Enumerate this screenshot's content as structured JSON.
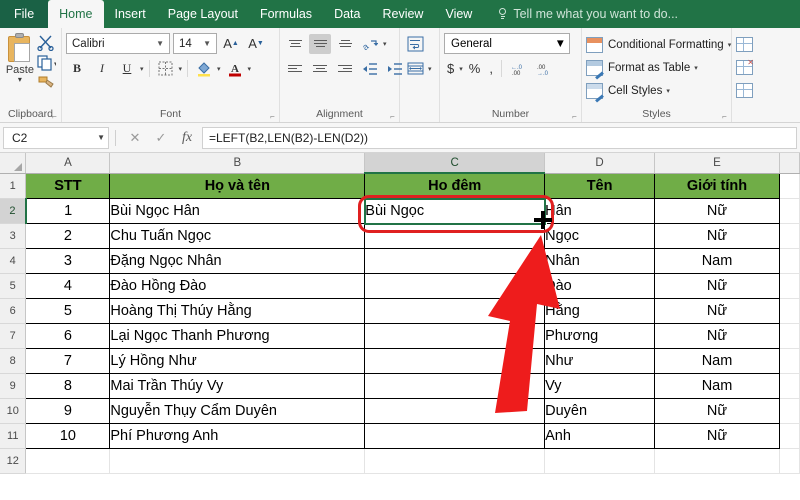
{
  "window": {
    "tabs": [
      {
        "label": "File",
        "active": false,
        "file": true
      },
      {
        "label": "Home",
        "active": true,
        "file": false
      },
      {
        "label": "Insert",
        "active": false,
        "file": false
      },
      {
        "label": "Page Layout",
        "active": false,
        "file": false
      },
      {
        "label": "Formulas",
        "active": false,
        "file": false
      },
      {
        "label": "Data",
        "active": false,
        "file": false
      },
      {
        "label": "Review",
        "active": false,
        "file": false
      },
      {
        "label": "View",
        "active": false,
        "file": false
      }
    ],
    "tell_me": "Tell me what you want to do...",
    "accent_green": "#217346",
    "header_fill": "#70ad47"
  },
  "ribbon": {
    "clipboard": {
      "label": "Clipboard",
      "paste_label": "Paste",
      "cut_icon": "scissors-icon",
      "copy_icon": "copy-icon",
      "format_painter_icon": "format-painter-icon"
    },
    "font": {
      "label": "Font",
      "font_name": "Calibri",
      "font_size": "14",
      "grow_label": "A",
      "shrink_label": "A",
      "bold_label": "B",
      "italic_label": "I",
      "underline_label": "U",
      "borders_icon": "borders-icon",
      "fill_color_icon": "fill-color-icon",
      "font_color_label": "A"
    },
    "alignment": {
      "label": "Alignment",
      "orientation_icon": "orientation-icon",
      "wrap_text_icon": "wrap-text-icon",
      "merge_center_icon": "merge-and-center-icon"
    },
    "number": {
      "label": "Number",
      "format": "General",
      "currency_label": "$",
      "percent_label": "%",
      "comma_label": ",",
      "increase_decimal_icon": "increase-decimal-icon",
      "decrease_decimal_icon": "decrease-decimal-icon"
    },
    "styles": {
      "label": "Styles",
      "items": [
        {
          "label": "Conditional Formatting",
          "icon": "conditional-formatting-icon"
        },
        {
          "label": "Format as Table",
          "icon": "format-as-table-icon"
        },
        {
          "label": "Cell Styles",
          "icon": "cell-styles-icon"
        }
      ]
    },
    "cells": {
      "items": [
        {
          "icon": "insert-cells-icon"
        },
        {
          "icon": "delete-cells-icon"
        },
        {
          "icon": "format-cells-icon"
        }
      ]
    }
  },
  "formula_bar": {
    "name_box": "C2",
    "cancel_icon": "cancel-icon",
    "enter_icon": "enter-icon",
    "function_icon": "fx",
    "formula": "=LEFT(B2,LEN(B2)-LEN(D2))"
  },
  "sheet": {
    "column_headers": [
      "A",
      "B",
      "C",
      "D",
      "E"
    ],
    "selected_column": "C",
    "row_headers": [
      "1",
      "2",
      "3",
      "4",
      "5",
      "6",
      "7",
      "8",
      "9",
      "10",
      "11",
      "12"
    ],
    "selected_row": "2",
    "header_row": [
      "STT",
      "Họ và tên",
      "Ho đêm",
      "Tên",
      "Giới tính"
    ],
    "rows": [
      {
        "stt": "1",
        "ho_va_ten": "Bùi Ngọc Hân",
        "ho_dem": "Bùi Ngọc",
        "ten": "Hân",
        "gioi_tinh": "Nữ"
      },
      {
        "stt": "2",
        "ho_va_ten": "Chu Tuấn Ngọc",
        "ho_dem": "",
        "ten": "Ngọc",
        "gioi_tinh": "Nữ"
      },
      {
        "stt": "3",
        "ho_va_ten": "Đặng Ngọc Nhân",
        "ho_dem": "",
        "ten": "Nhân",
        "gioi_tinh": "Nam"
      },
      {
        "stt": "4",
        "ho_va_ten": "Đào Hồng Đào",
        "ho_dem": "",
        "ten": "Đào",
        "gioi_tinh": "Nữ"
      },
      {
        "stt": "5",
        "ho_va_ten": "Hoàng Thị Thúy Hằng",
        "ho_dem": "",
        "ten": "Hằng",
        "gioi_tinh": "Nữ"
      },
      {
        "stt": "6",
        "ho_va_ten": "Lại Ngọc Thanh Phương",
        "ho_dem": "",
        "ten": "Phương",
        "gioi_tinh": "Nữ"
      },
      {
        "stt": "7",
        "ho_va_ten": "Lý Hồng Như",
        "ho_dem": "",
        "ten": "Như",
        "gioi_tinh": "Nam"
      },
      {
        "stt": "8",
        "ho_va_ten": "Mai Trần Thúy Vy",
        "ho_dem": "",
        "ten": "Vy",
        "gioi_tinh": "Nam"
      },
      {
        "stt": "9",
        "ho_va_ten": "Nguyễn Thụy Cẩm Duyên",
        "ho_dem": "",
        "ten": "Duyên",
        "gioi_tinh": "Nữ"
      },
      {
        "stt": "10",
        "ho_va_ten": "Phí Phương Anh",
        "ho_dem": "",
        "ten": "Anh",
        "gioi_tinh": "Nữ"
      }
    ]
  },
  "annotations": {
    "highlight_cell": "C2",
    "highlight_color": "#e02020",
    "arrow_color": "#e02020",
    "cursor_icon": "fill-handle-crosshair-cursor"
  }
}
